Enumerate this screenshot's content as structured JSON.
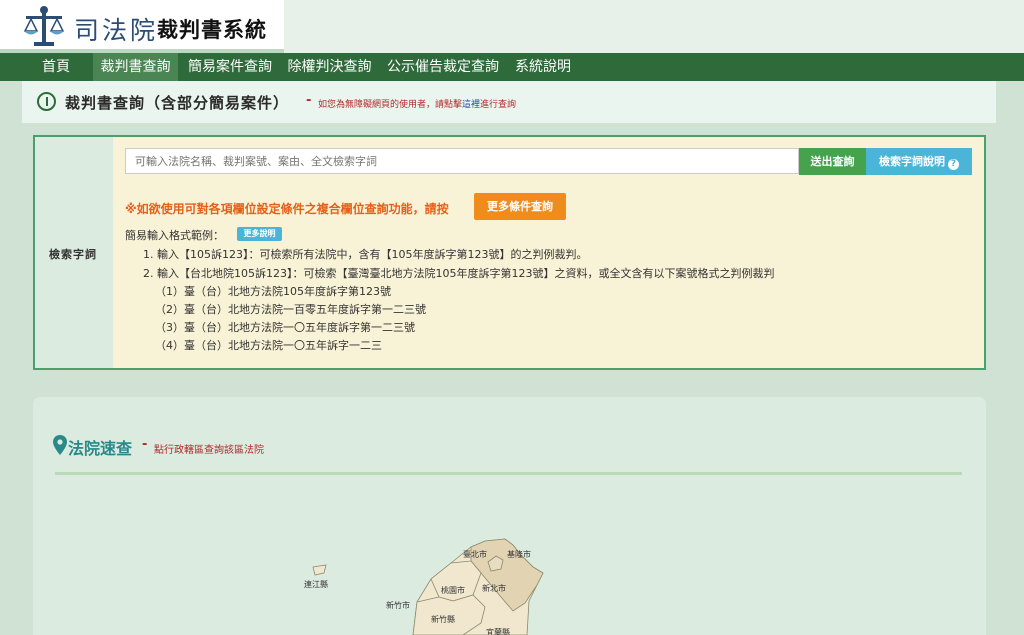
{
  "header": {
    "logo_text": "司法院",
    "system_name": "裁判書系統"
  },
  "nav": {
    "items": [
      {
        "label": "首頁"
      },
      {
        "label": "裁判書查詢"
      },
      {
        "label": "簡易案件查詢"
      },
      {
        "label": "除權判決查詢"
      },
      {
        "label": "公示催告裁定查詢"
      },
      {
        "label": "系統說明"
      }
    ]
  },
  "page_title": {
    "text": "裁判書查詢（含部分簡易案件）",
    "dash": "-",
    "note_before": "如您為無障礙網頁的使用者，請點擊",
    "note_link": "這裡",
    "note_after": "進行查詢"
  },
  "search": {
    "label": "檢索字詞",
    "placeholder": "可輸入法院名稱、裁判案號、案由、全文檢索字詞",
    "submit_label": "送出查詢",
    "help_label": "檢索字詞說明",
    "help_icon": "?",
    "advanced_text": "※如欲使用可對各項欄位設定條件之複合欄位查詢功能，請按",
    "more_conditions_label": "更多條件查詢",
    "examples_label": "簡易輸入格式範例：",
    "more_desc_label": "更多說明",
    "examples": [
      "1. 輸入【105訴123】：可檢索所有法院中，含有【105年度訴字第123號】的之判例裁判。",
      "2. 輸入【台北地院105訴123】：可檢索【臺灣臺北地方法院105年度訴字第123號】之資料，或全文含有以下案號格式之判例裁判",
      "（1）臺（台）北地方法院105年度訴字第123號",
      "（2）臺（台）北地方法院一百零五年度訴字第一二三號",
      "（3）臺（台）北地方法院一〇五年度訴字第一二三號",
      "（4）臺（台）北地方法院一〇五年訴字一二三"
    ]
  },
  "court_quick": {
    "title": "法院速查",
    "dash": "-",
    "note": "點行政轄區查詢該區法院",
    "map_labels": {
      "lianjiang": "連江縣",
      "taipei": "臺北市",
      "keelung": "基隆市",
      "taoyuan": "桃園市",
      "new_taipei": "新北市",
      "hsinchu_city": "新竹市",
      "hsinchu_county": "新竹縣",
      "yilan": "宜蘭縣"
    }
  },
  "colors": {
    "nav_bg": "#2f6b3a",
    "nav_active": "#4b8553",
    "submit_btn": "#45a34e",
    "help_btn": "#4ab4d9",
    "more_cond_btn": "#f08c1c",
    "advanced_text": "#e6601a",
    "note_red": "#b02a2a",
    "court_title": "#2a8a8a"
  }
}
